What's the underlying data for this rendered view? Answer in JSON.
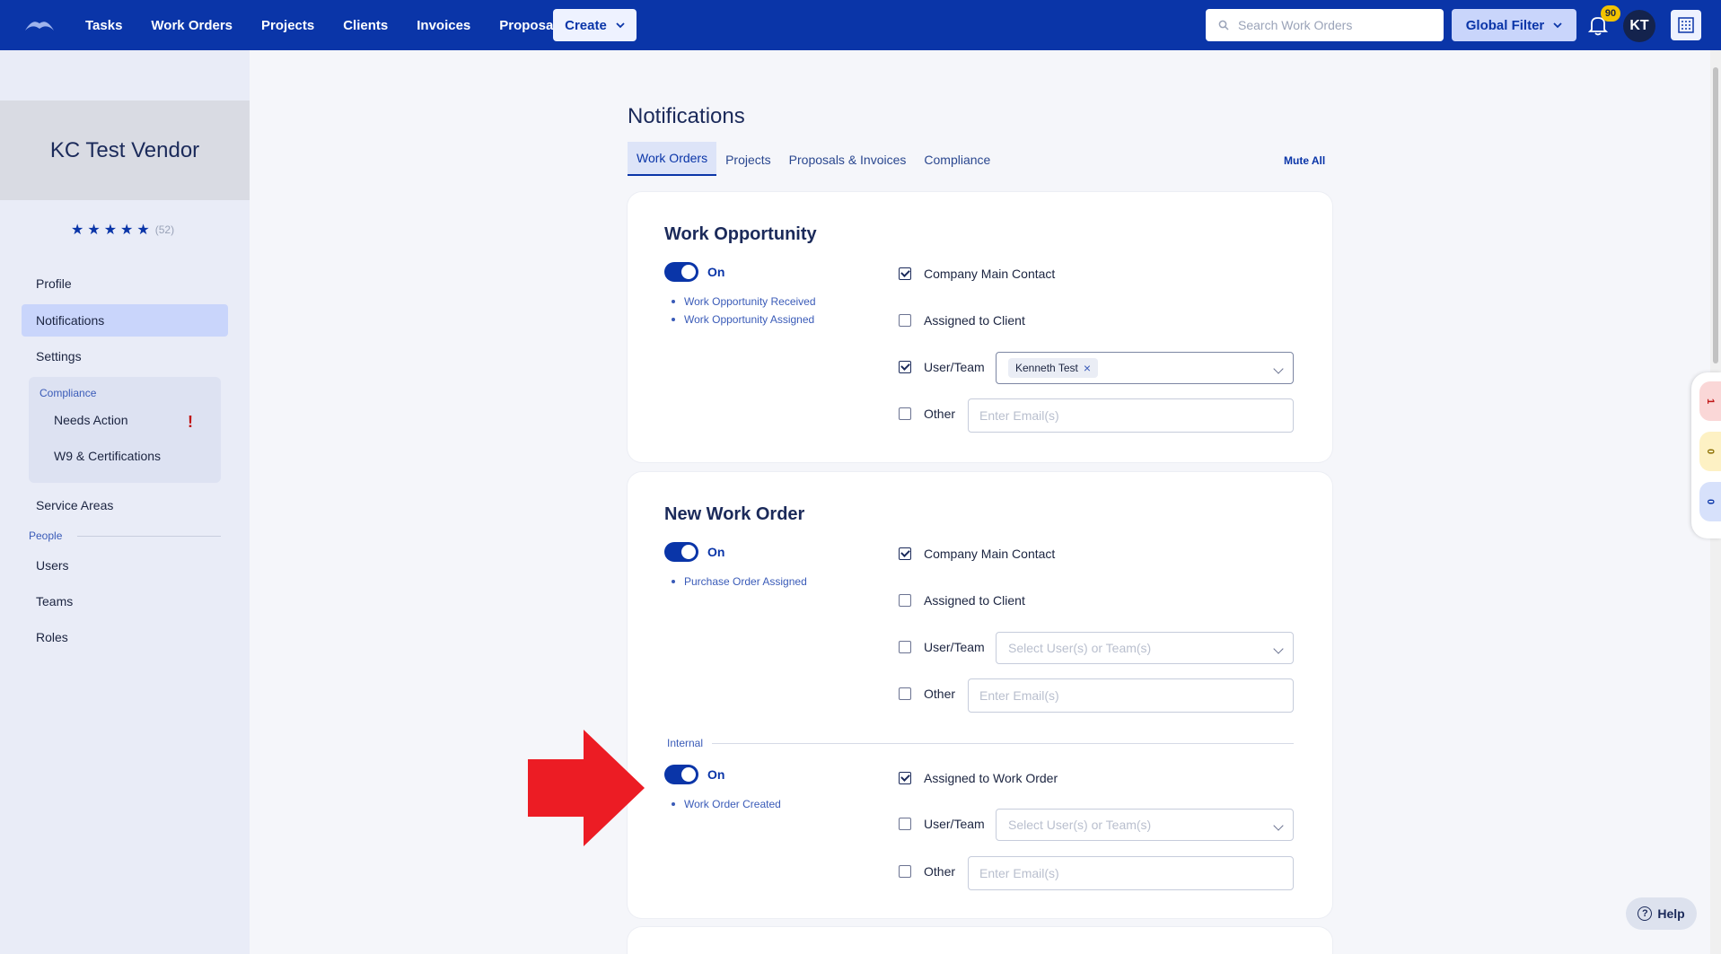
{
  "nav": {
    "links": [
      "Tasks",
      "Work Orders",
      "Projects",
      "Clients",
      "Invoices",
      "Proposals"
    ],
    "create_label": "Create",
    "search_placeholder": "Search Work Orders",
    "global_filter_label": "Global Filter",
    "notification_count": "90",
    "avatar_initials": "KT"
  },
  "sidebar": {
    "vendor_name": "KC Test Vendor",
    "rating_count": "(52)",
    "items": {
      "profile": "Profile",
      "notifications": "Notifications",
      "settings": "Settings",
      "compliance_label": "Compliance",
      "needs_action": "Needs Action",
      "needs_action_flag": "!",
      "w9": "W9 & Certifications",
      "service_areas": "Service Areas",
      "people_label": "People",
      "users": "Users",
      "teams": "Teams",
      "roles": "Roles"
    }
  },
  "main": {
    "title": "Notifications",
    "tabs": [
      "Work Orders",
      "Projects",
      "Proposals & Invoices",
      "Compliance"
    ],
    "mute_all": "Mute All",
    "work_opportunity": {
      "title": "Work Opportunity",
      "toggle_label": "On",
      "events": [
        "Work Opportunity Received",
        "Work Opportunity Assigned"
      ],
      "company_main_contact": "Company Main Contact",
      "assigned_to_client": "Assigned to Client",
      "user_team": "User/Team",
      "user_chip": "Kenneth Test",
      "other": "Other",
      "email_placeholder": "Enter Email(s)"
    },
    "new_work_order": {
      "title": "New Work Order",
      "toggle_label": "On",
      "events": [
        "Purchase Order Assigned"
      ],
      "company_main_contact": "Company Main Contact",
      "assigned_to_client": "Assigned to Client",
      "user_team": "User/Team",
      "select_placeholder": "Select User(s) or Team(s)",
      "other": "Other",
      "email_placeholder": "Enter Email(s)",
      "internal_label": "Internal",
      "internal_toggle_label": "On",
      "internal_events": [
        "Work Order Created"
      ],
      "assigned_to_work_order": "Assigned to Work Order",
      "internal_user_team": "User/Team",
      "internal_select_placeholder": "Select User(s) or Team(s)",
      "internal_other": "Other",
      "internal_email_placeholder": "Enter Email(s)"
    }
  },
  "right_rail": {
    "pills": [
      "1",
      "0",
      "0"
    ],
    "help_label": "Help"
  },
  "colors": {
    "primary": "#0a35a8",
    "sidebar_bg": "#e9ecf7",
    "arrow": "#ec1c24"
  }
}
